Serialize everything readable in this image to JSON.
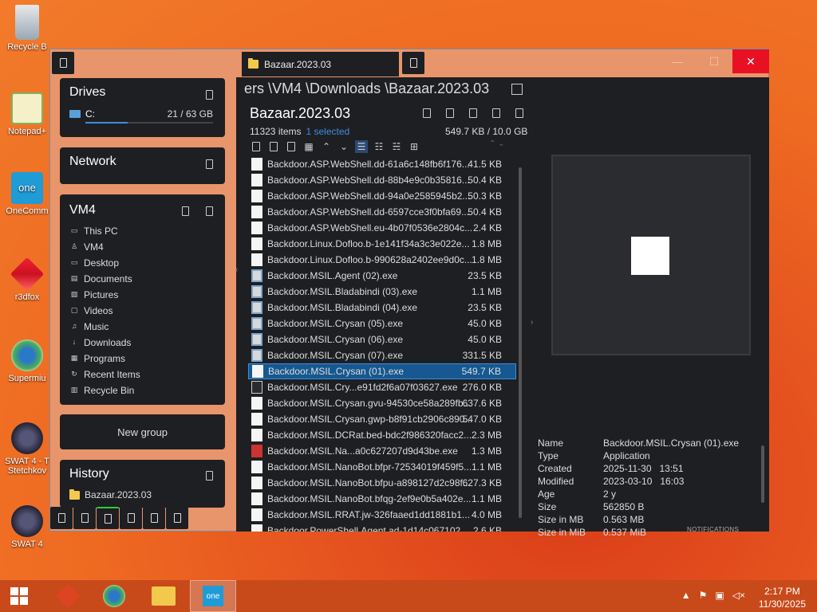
{
  "desktop": {
    "icons": [
      {
        "label": "Recycle B",
        "icon": "recycle-bin-icon"
      },
      {
        "label": "Notepad+",
        "icon": "notepad-plus-icon"
      },
      {
        "label": "OneComm",
        "icon": "onecomm-icon"
      },
      {
        "label": "r3dfox",
        "icon": "r3dfox-icon"
      },
      {
        "label": "Supermiu",
        "icon": "supermium-icon"
      },
      {
        "label": "SWAT 4 - T",
        "label2": "Stetchkov",
        "icon": "swat4-icon"
      },
      {
        "label": "SWAT 4",
        "icon": "swat4-icon"
      }
    ]
  },
  "window": {
    "tab_title": "Bazaar.2023.03",
    "controls": {
      "minimize": "—",
      "maximize": "☐",
      "close": "✕"
    }
  },
  "drives": {
    "title": "Drives",
    "items": [
      {
        "letter": "C:",
        "usage": "21 / 63 GB",
        "fill": 0.33
      }
    ]
  },
  "network": {
    "title": "Network"
  },
  "vm4": {
    "title": "VM4",
    "items": [
      {
        "label": "This PC",
        "icon": "pc-icon"
      },
      {
        "label": "VM4",
        "icon": "user-icon"
      },
      {
        "label": "Desktop",
        "icon": "desktop-icon"
      },
      {
        "label": "Documents",
        "icon": "documents-icon"
      },
      {
        "label": "Pictures",
        "icon": "pictures-icon"
      },
      {
        "label": "Videos",
        "icon": "videos-icon"
      },
      {
        "label": "Music",
        "icon": "music-icon"
      },
      {
        "label": "Downloads",
        "icon": "downloads-icon"
      },
      {
        "label": "Programs",
        "icon": "programs-icon"
      },
      {
        "label": "Recent Items",
        "icon": "recent-icon"
      },
      {
        "label": "Recycle Bin",
        "icon": "recycle-bin-icon"
      }
    ]
  },
  "new_group": {
    "label": "New group"
  },
  "history": {
    "title": "History",
    "items": [
      {
        "label": "Bazaar.2023.03"
      }
    ]
  },
  "pane": {
    "breadcrumb": "ers \\VM4 \\Downloads \\Bazaar.2023.03",
    "folder_title": "Bazaar.2023.03",
    "item_count": "11323 items",
    "selected": "1 selected",
    "sizes": "549.7 KB / 10.0 GB"
  },
  "files": [
    {
      "name": "Backdoor.ASP.WebShell.dd-61a6c148fb6f176...",
      "size": "41.5 KB",
      "type": "doc"
    },
    {
      "name": "Backdoor.ASP.WebShell.dd-88b4e9c0b35816...",
      "size": "50.4 KB",
      "type": "doc"
    },
    {
      "name": "Backdoor.ASP.WebShell.dd-94a0e2585945b2...",
      "size": "50.3 KB",
      "type": "doc"
    },
    {
      "name": "Backdoor.ASP.WebShell.dd-6597cce3f0bfa69...",
      "size": "50.4 KB",
      "type": "doc"
    },
    {
      "name": "Backdoor.ASP.WebShell.eu-4b07f0536e2804c...",
      "size": "2.4 KB",
      "type": "doc"
    },
    {
      "name": "Backdoor.Linux.Dofloo.b-1e141f34a3c3e022e...",
      "size": "1.8 MB",
      "type": "doc"
    },
    {
      "name": "Backdoor.Linux.Dofloo.b-990628a2402ee9d0c...",
      "size": "1.8 MB",
      "type": "doc"
    },
    {
      "name": "Backdoor.MSIL.Agent (02).exe",
      "size": "23.5 KB",
      "type": "exe"
    },
    {
      "name": "Backdoor.MSIL.Bladabindi (03).exe",
      "size": "1.1 MB",
      "type": "exe"
    },
    {
      "name": "Backdoor.MSIL.Bladabindi (04).exe",
      "size": "23.5 KB",
      "type": "exe"
    },
    {
      "name": "Backdoor.MSIL.Crysan (05).exe",
      "size": "45.0 KB",
      "type": "exe"
    },
    {
      "name": "Backdoor.MSIL.Crysan (06).exe",
      "size": "45.0 KB",
      "type": "exe"
    },
    {
      "name": "Backdoor.MSIL.Crysan (07).exe",
      "size": "331.5 KB",
      "type": "exe"
    },
    {
      "name": "Backdoor.MSIL.Crysan (01).exe",
      "size": "549.7 KB",
      "type": "doc",
      "selected": true
    },
    {
      "name": "Backdoor.MSIL.Cry...e91fd2f6a07f03627.exe",
      "size": "276.0 KB",
      "type": "dark"
    },
    {
      "name": "Backdoor.MSIL.Crysan.gvu-94530ce58a289fb...",
      "size": "637.6 KB",
      "type": "doc"
    },
    {
      "name": "Backdoor.MSIL.Crysan.gwp-b8f91cb2906c890...",
      "size": "547.0 KB",
      "type": "doc"
    },
    {
      "name": "Backdoor.MSIL.DCRat.bed-bdc2f986320facc2...",
      "size": "2.3 MB",
      "type": "doc"
    },
    {
      "name": "Backdoor.MSIL.Na...a0c627207d9d43be.exe",
      "size": "1.3 MB",
      "type": "red"
    },
    {
      "name": "Backdoor.MSIL.NanoBot.bfpr-72534019f459f5...",
      "size": "1.1 MB",
      "type": "doc"
    },
    {
      "name": "Backdoor.MSIL.NanoBot.bfpu-a898127d2c98f...",
      "size": "627.3 KB",
      "type": "doc"
    },
    {
      "name": "Backdoor.MSIL.NanoBot.bfqg-2ef9e0b5a402e...",
      "size": "1.1 MB",
      "type": "doc"
    },
    {
      "name": "Backdoor.MSIL.RRAT.jw-326faaed1dd1881b1...",
      "size": "4.0 MB",
      "type": "doc"
    },
    {
      "name": "Backdoor.PowerShell.Agent.ad-1d14c067102...",
      "size": "2.6 KB",
      "type": "doc"
    }
  ],
  "properties": [
    {
      "key": "Name",
      "value": "Backdoor.MSIL.Crysan (01).exe"
    },
    {
      "key": "Type",
      "value": "Application"
    },
    {
      "key": "Created",
      "value": "2025-11-30   13:51"
    },
    {
      "key": "Modified",
      "value": "2023-03-10   16:03"
    },
    {
      "key": "Age",
      "value": "2 y"
    },
    {
      "key": "Size",
      "value": "562850 B"
    },
    {
      "key": "Size in MB",
      "value": "0.563 MB"
    },
    {
      "key": "Size in MiB",
      "value": "0.537 MiB"
    }
  ],
  "notifications_label": "NOTIFICATIONS",
  "taskbar": {
    "time": "2:17 PM",
    "date": "11/30/2025",
    "apps": [
      "r3dfox-icon",
      "supermium-icon",
      "file-explorer-icon",
      "onecomm-icon"
    ]
  },
  "colors": {
    "accent": "#3d8ee0",
    "selection": "#16588f",
    "close": "#e81123",
    "panel": "#1e1f22"
  }
}
